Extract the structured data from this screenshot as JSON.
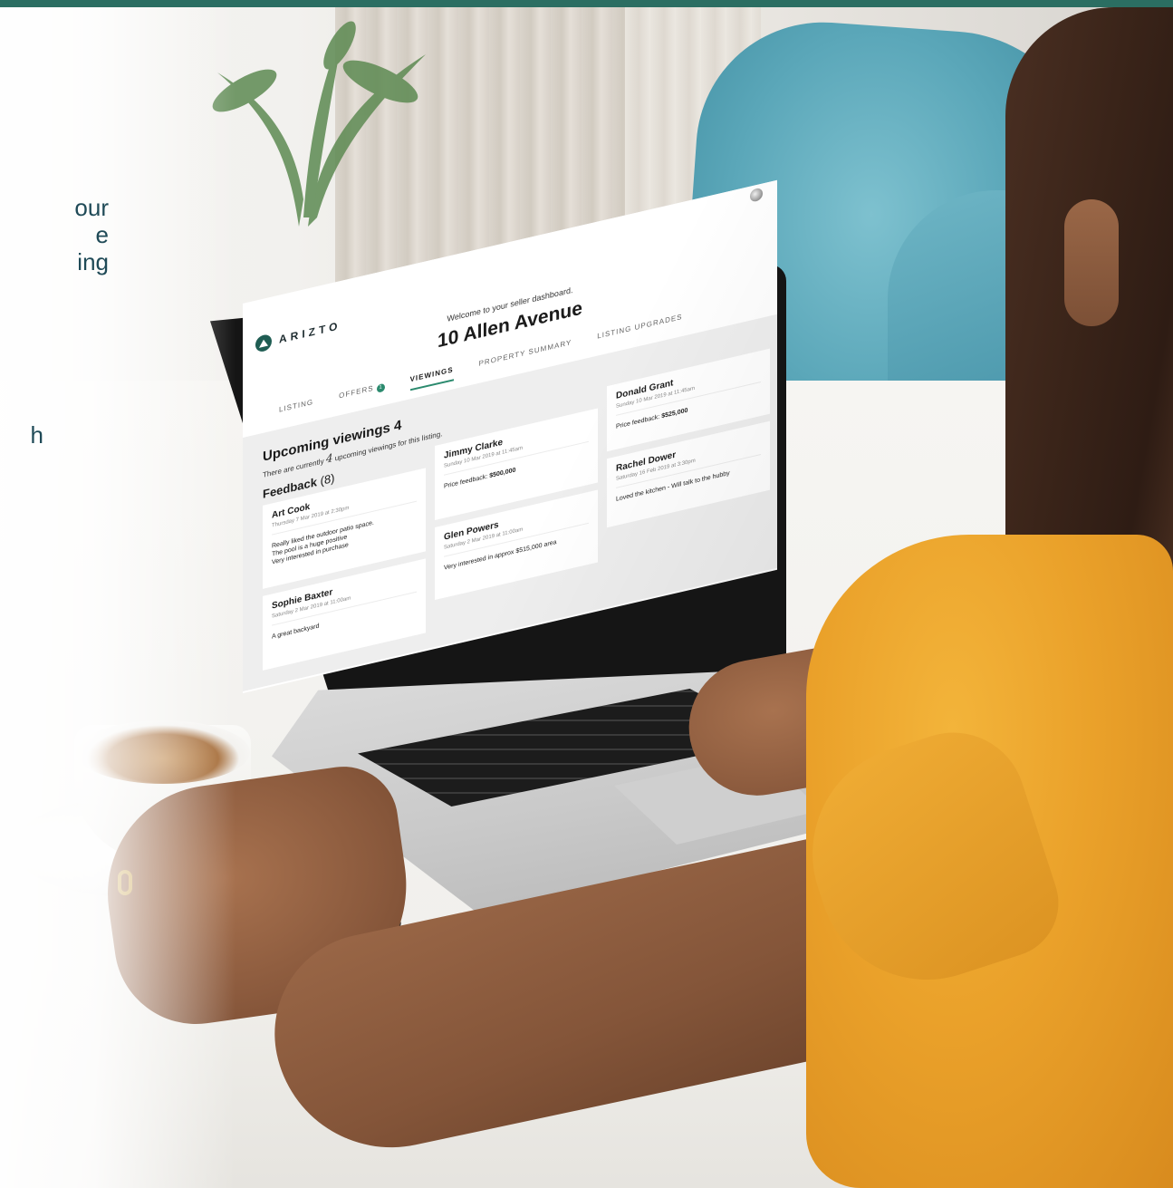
{
  "scene": {
    "headline_lines": [
      "our",
      "e",
      "ing"
    ],
    "headline_line_4": "h",
    "colors": {
      "brand_bar": "#2b6e62",
      "headline_text": "#1f4a57",
      "accent_green": "#2b8a6e",
      "chair_blue": "#5ba7b9",
      "shirt_yellow": "#eaa12a"
    }
  },
  "app": {
    "logo_text": "ARIZTO",
    "welcome": "Welcome to your seller dashboard.",
    "address": "10 Allen Avenue",
    "tabs": [
      {
        "label": "LISTING",
        "active": false
      },
      {
        "label": "OFFERS",
        "badge": "1",
        "active": false
      },
      {
        "label": "VIEWINGS",
        "active": true
      },
      {
        "label": "PROPERTY SUMMARY",
        "active": false
      },
      {
        "label": "LISTING UPGRADES",
        "active": false
      }
    ],
    "upcoming": {
      "title": "Upcoming viewings 4",
      "sub_before": "There are currently",
      "sub_count": "4",
      "sub_after": "upcoming viewings for this listing."
    },
    "feedback": {
      "title": "Feedback",
      "count": "(8)",
      "cards": [
        {
          "name": "Art Cook",
          "date": "Thursday 7 Mar 2019 at 2:30pm",
          "lines": [
            "Really liked the outdoor patio space.",
            "The pool is a huge positive",
            "Very interested in purchase"
          ]
        },
        {
          "name": "Jimmy Clarke",
          "date": "Sunday 10 Mar 2019 at 11:45am",
          "price_label": "Price feedback:",
          "price": "$500,000"
        },
        {
          "name": "Donald Grant",
          "date": "Sunday 10 Mar 2019 at 11:45am",
          "price_label": "Price feedback:",
          "price": "$525,000"
        },
        {
          "name": "Sophie Baxter",
          "date": "Saturday 2 Mar 2019 at 11:00am",
          "text": "A great backyard"
        },
        {
          "name": "Glen Powers",
          "date": "Saturday 2 Mar 2019 at 11:00am",
          "text": "Very interested in approx $515,000 area"
        },
        {
          "name": "Rachel Dower",
          "date": "Saturday 16 Feb 2019 at 3:30pm",
          "text": "Loved the kitchen - Will talk to the hubby"
        }
      ]
    }
  }
}
